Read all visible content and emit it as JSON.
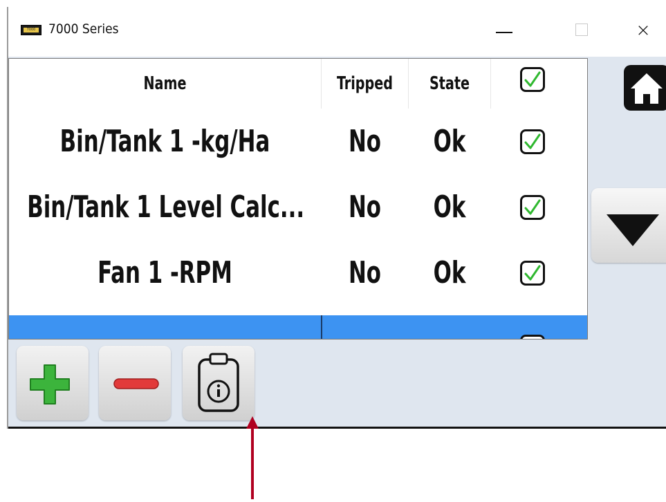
{
  "window": {
    "title": "7000 Series",
    "icon_label": "7000",
    "close_glyph": "×"
  },
  "table": {
    "headers": [
      "Name",
      "Tripped",
      "State"
    ],
    "rows": [
      {
        "name": "Bin/Tank 1 -kg/Ha",
        "tripped": "No",
        "state": "Ok",
        "checked": true
      },
      {
        "name": "Bin/Tank 1 Level Calc...",
        "tripped": "No",
        "state": "Ok",
        "checked": true
      },
      {
        "name": "Fan 1 -RPM",
        "tripped": "No",
        "state": "Ok",
        "checked": true
      }
    ],
    "selected_row_partial": true
  },
  "toolbar": {
    "add_icon": "plus-icon",
    "remove_icon": "minus-icon",
    "info_icon": "clipboard-info-icon"
  },
  "nav": {
    "home_icon": "home-icon",
    "down_icon": "triangle-down-icon"
  },
  "colors": {
    "client_background": "#dfe6ef",
    "selection": "#3d93f2",
    "check_green": "#2fb82f",
    "add_green": "#3cb43c",
    "remove_red": "#e23a3a",
    "annotation_arrow": "#b00020"
  }
}
